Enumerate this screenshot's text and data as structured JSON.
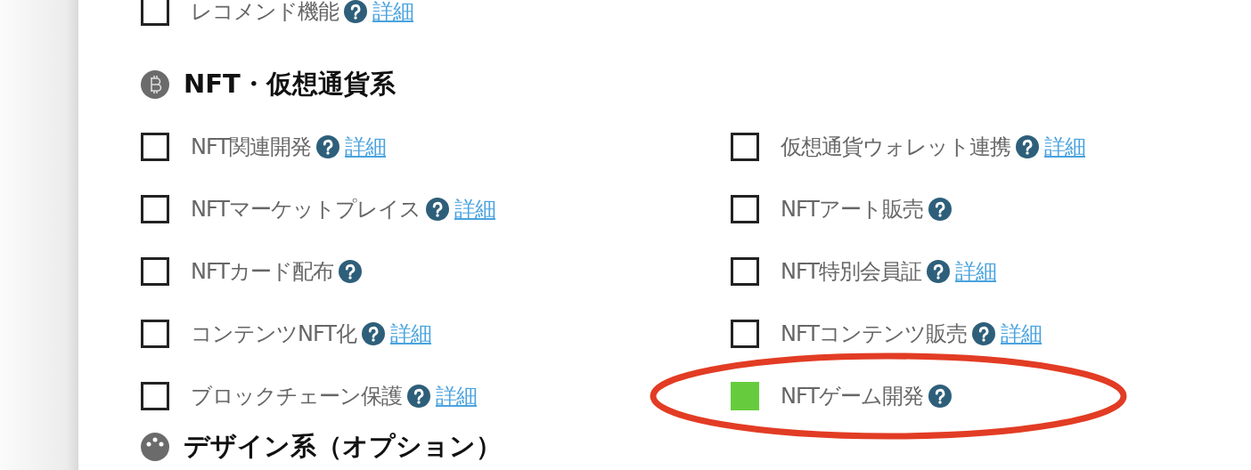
{
  "sections": [
    {
      "items": [
        {
          "label": "レコメンド機能",
          "checked": false,
          "link": "詳細",
          "circled": false
        }
      ]
    },
    {
      "title": "NFT・仮想通貨系",
      "items": [
        {
          "label": "NFT関連開発",
          "checked": false,
          "link": "詳細",
          "circled": false
        },
        {
          "label": "仮想通貨ウォレット連携",
          "checked": false,
          "link": "詳細",
          "circled": false
        },
        {
          "label": "NFTマーケットプレイス",
          "checked": false,
          "link": "詳細",
          "circled": false
        },
        {
          "label": "NFTアート販売",
          "checked": false,
          "circled": false
        },
        {
          "label": "NFTカード配布",
          "checked": false,
          "circled": false
        },
        {
          "label": "NFT特別会員証",
          "checked": false,
          "link": "詳細",
          "circled": false
        },
        {
          "label": "コンテンツNFT化",
          "checked": false,
          "link": "詳細",
          "circled": false
        },
        {
          "label": "NFTコンテンツ販売",
          "checked": false,
          "link": "詳細",
          "circled": false
        },
        {
          "label": "ブロックチェーン保護",
          "checked": false,
          "link": "詳細",
          "circled": false
        },
        {
          "label": "NFTゲーム開発",
          "checked": true,
          "circled": true
        }
      ]
    },
    {
      "title": "デザイン系（オプション）"
    }
  ]
}
